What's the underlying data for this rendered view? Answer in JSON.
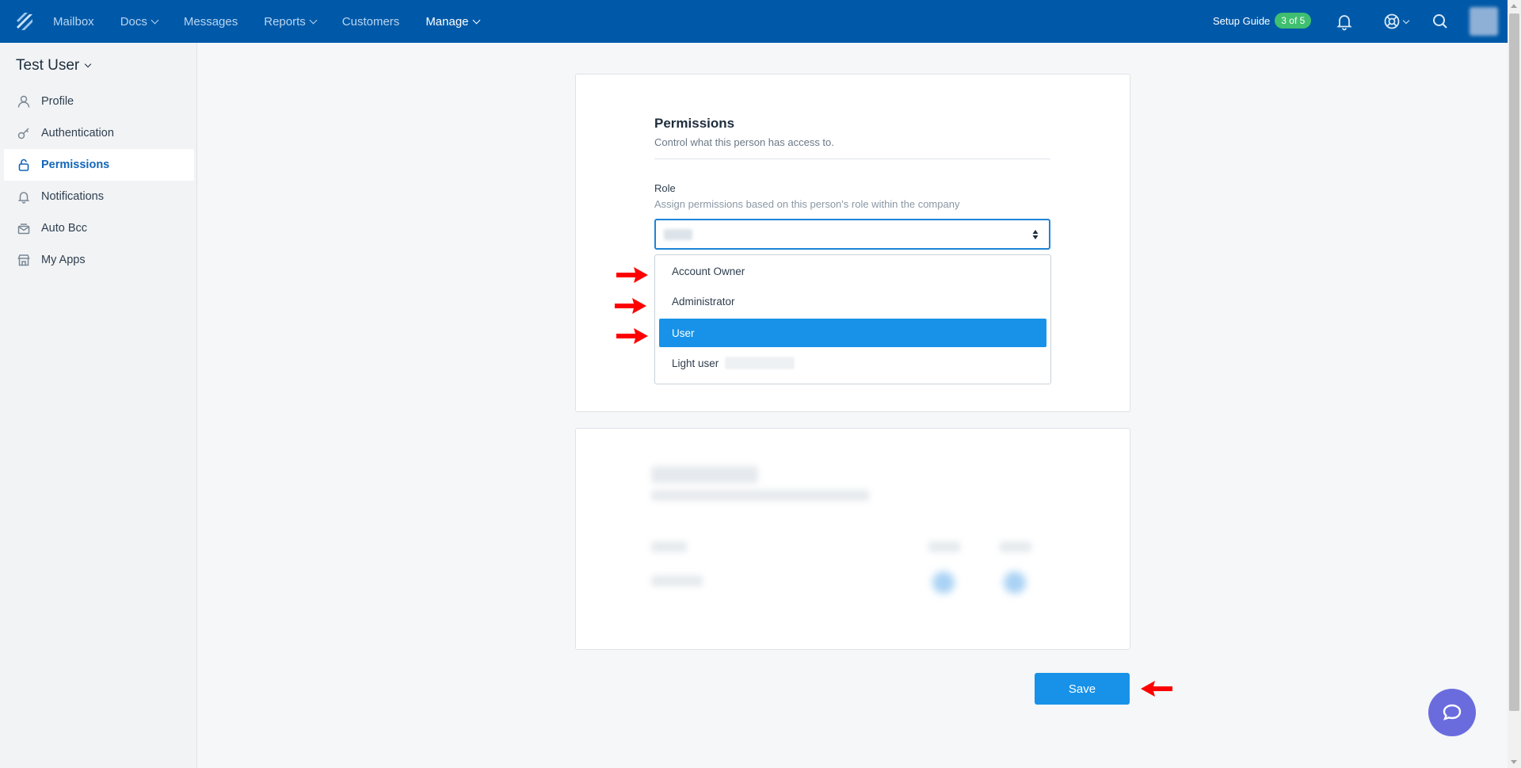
{
  "topnav": {
    "items": [
      {
        "label": "Mailbox",
        "dropdown": false,
        "active": false
      },
      {
        "label": "Docs",
        "dropdown": true,
        "active": false
      },
      {
        "label": "Messages",
        "dropdown": false,
        "active": false
      },
      {
        "label": "Reports",
        "dropdown": true,
        "active": false
      },
      {
        "label": "Customers",
        "dropdown": false,
        "active": false
      },
      {
        "label": "Manage",
        "dropdown": true,
        "active": true
      }
    ],
    "setup_label": "Setup Guide",
    "setup_badge": "3 of 5",
    "icons": [
      "bell-icon",
      "help-lifebuoy-icon",
      "search-icon"
    ],
    "colors": {
      "bar": "#0059a8",
      "badge": "#3fbf6f"
    }
  },
  "sidebar": {
    "user_name": "Test User",
    "items": [
      {
        "label": "Profile",
        "icon": "user-icon",
        "active": false
      },
      {
        "label": "Authentication",
        "icon": "key-icon",
        "active": false
      },
      {
        "label": "Permissions",
        "icon": "lock-icon",
        "active": true
      },
      {
        "label": "Notifications",
        "icon": "bell-icon",
        "active": false
      },
      {
        "label": "Auto Bcc",
        "icon": "mail-stack-icon",
        "active": false
      },
      {
        "label": "My Apps",
        "icon": "store-icon",
        "active": false
      }
    ]
  },
  "permissions": {
    "title": "Permissions",
    "subtitle": "Control what this person has access to.",
    "role_label": "Role",
    "role_help": "Assign permissions based on this person's role within the company",
    "options": [
      {
        "label": "Account Owner",
        "selected": false
      },
      {
        "label": "Administrator",
        "selected": false
      },
      {
        "label": "User",
        "selected": true
      },
      {
        "label": "Light user",
        "selected": false
      }
    ]
  },
  "save_label": "Save",
  "accent_color": "#1792e8"
}
